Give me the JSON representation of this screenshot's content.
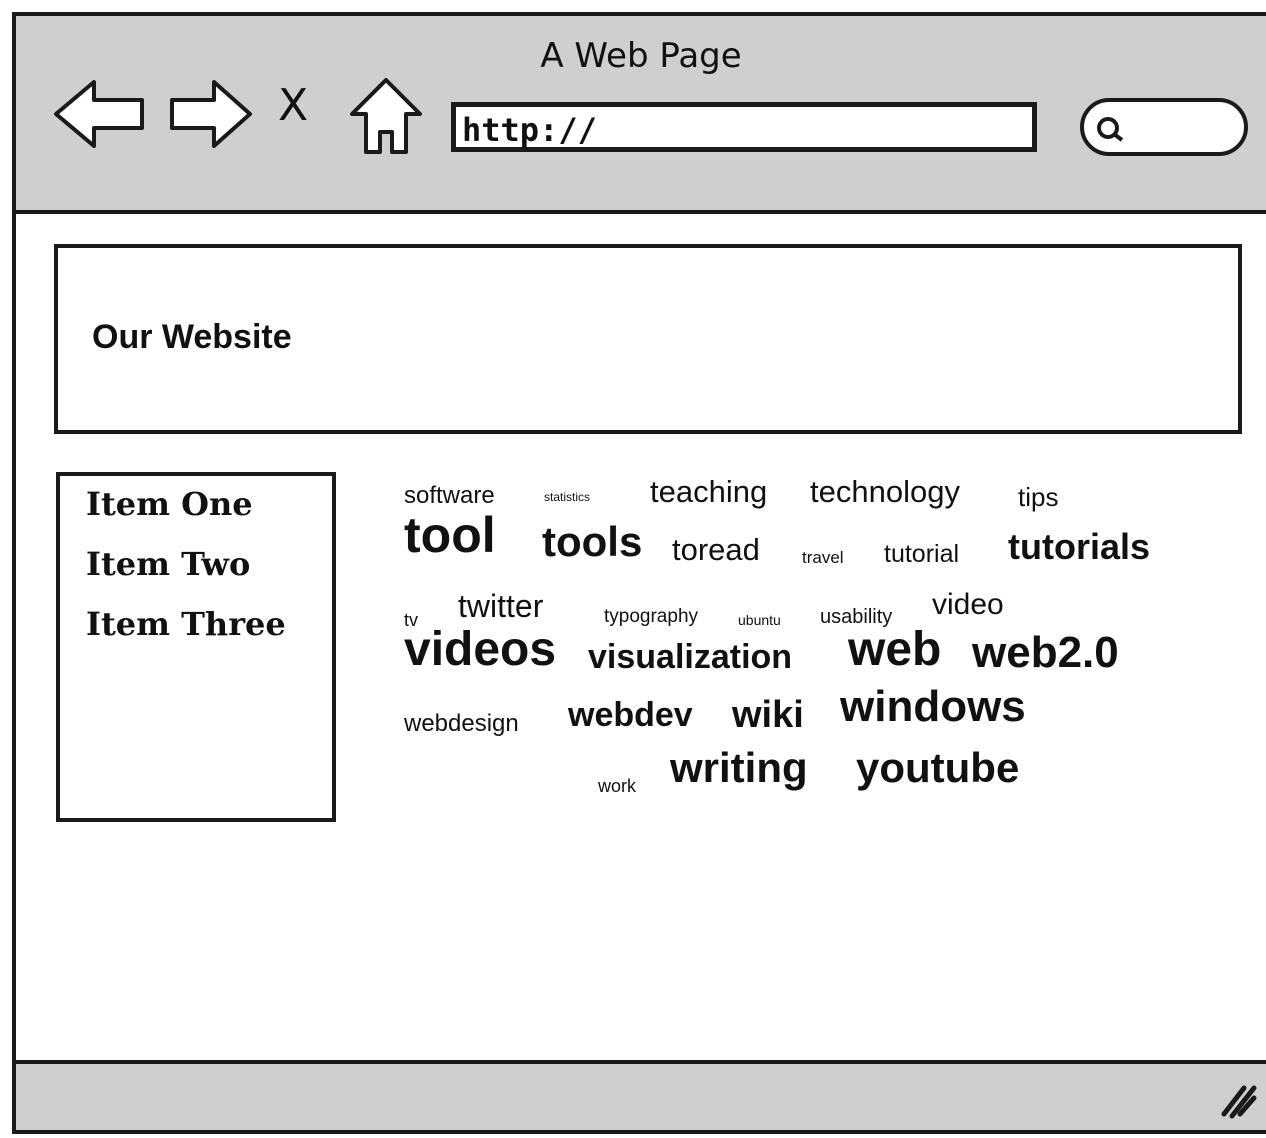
{
  "window": {
    "title": "A Web Page"
  },
  "toolbar": {
    "back_icon": "back-arrow-icon",
    "forward_icon": "forward-arrow-icon",
    "stop_label": "X",
    "home_icon": "home-icon",
    "url": "http://",
    "search_icon": "search-icon"
  },
  "header": {
    "title": "Our Website"
  },
  "sidebar": {
    "items": [
      {
        "label": "Item One"
      },
      {
        "label": "Item Two"
      },
      {
        "label": "Item Three"
      }
    ]
  },
  "tag_cloud": {
    "tags": [
      {
        "text": "software"
      },
      {
        "text": "statistics"
      },
      {
        "text": "teaching"
      },
      {
        "text": "technology"
      },
      {
        "text": "tips"
      },
      {
        "text": "tool"
      },
      {
        "text": "tools"
      },
      {
        "text": "toread"
      },
      {
        "text": "travel"
      },
      {
        "text": "tutorial"
      },
      {
        "text": "tutorials"
      },
      {
        "text": "tv"
      },
      {
        "text": "twitter"
      },
      {
        "text": "typography"
      },
      {
        "text": "ubuntu"
      },
      {
        "text": "usability"
      },
      {
        "text": "video"
      },
      {
        "text": "videos"
      },
      {
        "text": "visualization"
      },
      {
        "text": "web"
      },
      {
        "text": "web2.0"
      },
      {
        "text": "webdesign"
      },
      {
        "text": "webdev"
      },
      {
        "text": "wiki"
      },
      {
        "text": "windows"
      },
      {
        "text": "work"
      },
      {
        "text": "writing"
      },
      {
        "text": "youtube"
      }
    ]
  },
  "status_bar": {
    "grip_icon": "resize-grip-icon"
  }
}
